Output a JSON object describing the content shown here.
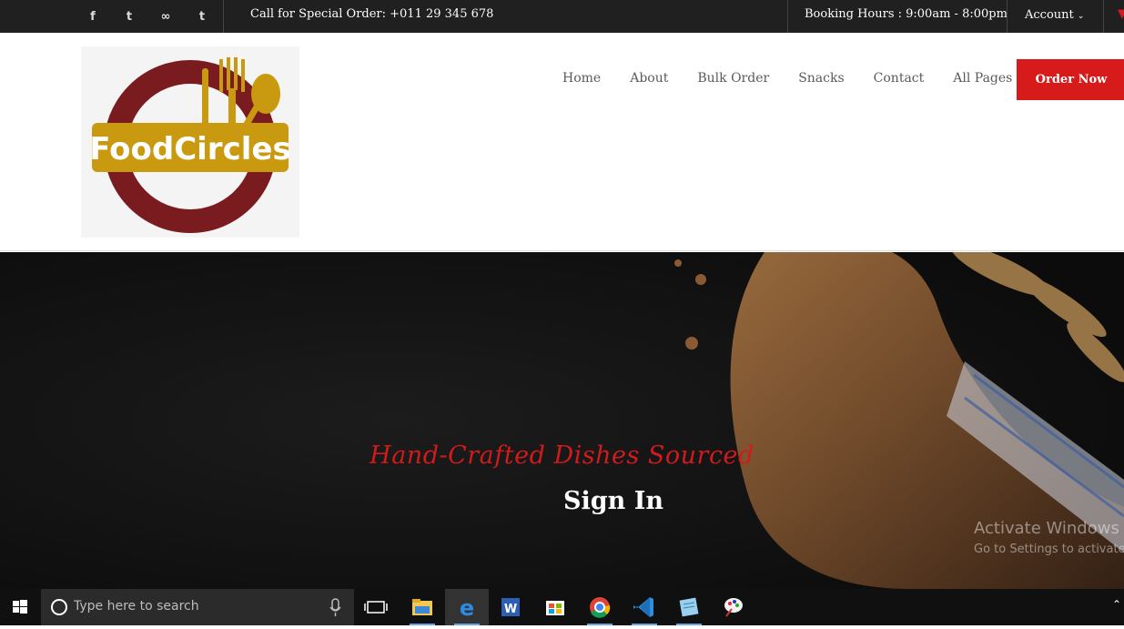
{
  "topbar": {
    "social_icons": [
      "facebook-icon",
      "twitter-icon",
      "tripadvisor-icon",
      "tumblr-icon"
    ],
    "social_glyphs": [
      "f",
      "t",
      "∞",
      "t"
    ],
    "call_text": "Call for Special Order: +011 29 345 678",
    "booking_text": "Booking Hours : 9:00am - 8:00pm",
    "account_label": "Account"
  },
  "header": {
    "logo_text": "FoodCircles",
    "nav": [
      "Home",
      "About",
      "Bulk Order",
      "Snacks",
      "Contact",
      "All Pages"
    ],
    "order_button": "Order Now"
  },
  "hero": {
    "subtitle": "Hand-Crafted Dishes Sourced",
    "title": "Sign In"
  },
  "watermark": {
    "line1": "Activate Windows",
    "line2": "Go to Settings to activate"
  },
  "taskbar": {
    "search_placeholder": "Type here to search",
    "apps": [
      "task-view-icon",
      "file-explorer-icon",
      "edge-icon",
      "word-icon",
      "store-icon",
      "chrome-icon",
      "vscode-icon",
      "notepad-icon",
      "paint-icon"
    ]
  },
  "colors": {
    "accent": "#d71a1a",
    "topbar": "#202020",
    "logo_gold": "#c99a0f",
    "logo_maroon": "#7a1c1f"
  }
}
